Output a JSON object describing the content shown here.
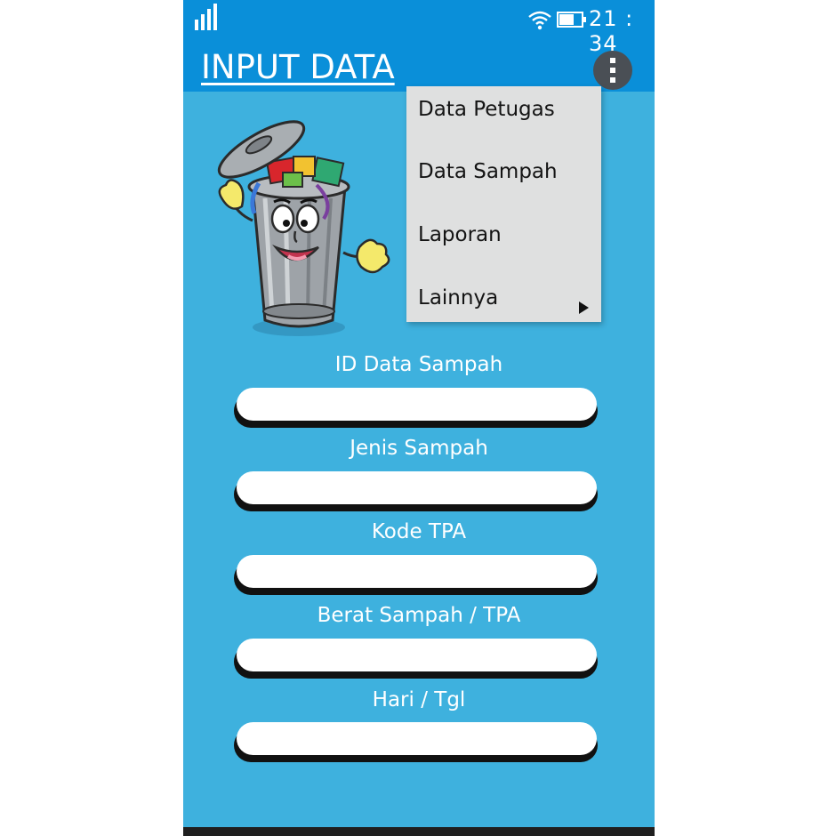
{
  "status_bar": {
    "time": "21 : 34",
    "signal_icon": "signal-bars-icon",
    "wifi_icon": "wifi-icon",
    "battery_icon": "battery-icon"
  },
  "app_bar": {
    "title": "INPUT DATA",
    "overflow_icon": "more-vert-icon",
    "color": "#0a8fd9"
  },
  "menu": {
    "items": [
      {
        "label": "Data Petugas"
      },
      {
        "label": "Data Sampah"
      },
      {
        "label": "Laporan"
      },
      {
        "label": "Lainnya",
        "has_submenu": true
      }
    ]
  },
  "mascot": {
    "icon": "trash-can-mascot-icon"
  },
  "form": {
    "background": "#3eb1de",
    "fields": [
      {
        "label": "ID Data Sampah",
        "value": ""
      },
      {
        "label": "Jenis Sampah",
        "value": ""
      },
      {
        "label": "Kode TPA",
        "value": ""
      },
      {
        "label": "Berat Sampah / TPA",
        "value": ""
      },
      {
        "label": "Hari / Tgl",
        "value": ""
      }
    ]
  }
}
